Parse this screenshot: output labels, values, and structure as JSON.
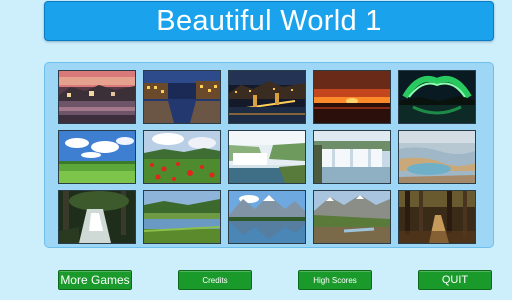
{
  "title": "Beautiful World 1",
  "buttons": {
    "more_games": "More Games",
    "credits": "Credits",
    "high_scores": "High Scores",
    "quit": "QUIT"
  },
  "colors": {
    "background": "#cdeefb",
    "title_bar": "#1aa3ec",
    "panel": "#9ed6f5",
    "button": "#1b9a2c",
    "text": "#ffffff"
  },
  "gallery": {
    "rows": 3,
    "columns": 5,
    "thumbnails": [
      "town-lake-sunset",
      "night-canal-city",
      "night-bridge-city",
      "red-sunset-horizon",
      "aurora-over-lake",
      "green-meadow-clouds",
      "poppy-field",
      "waterfall-cliffs",
      "wide-waterfall",
      "geothermal-terraces",
      "forest-stream",
      "meadow-lake",
      "mountain-reflection-lake",
      "mountain-valley",
      "forest-trail"
    ]
  }
}
